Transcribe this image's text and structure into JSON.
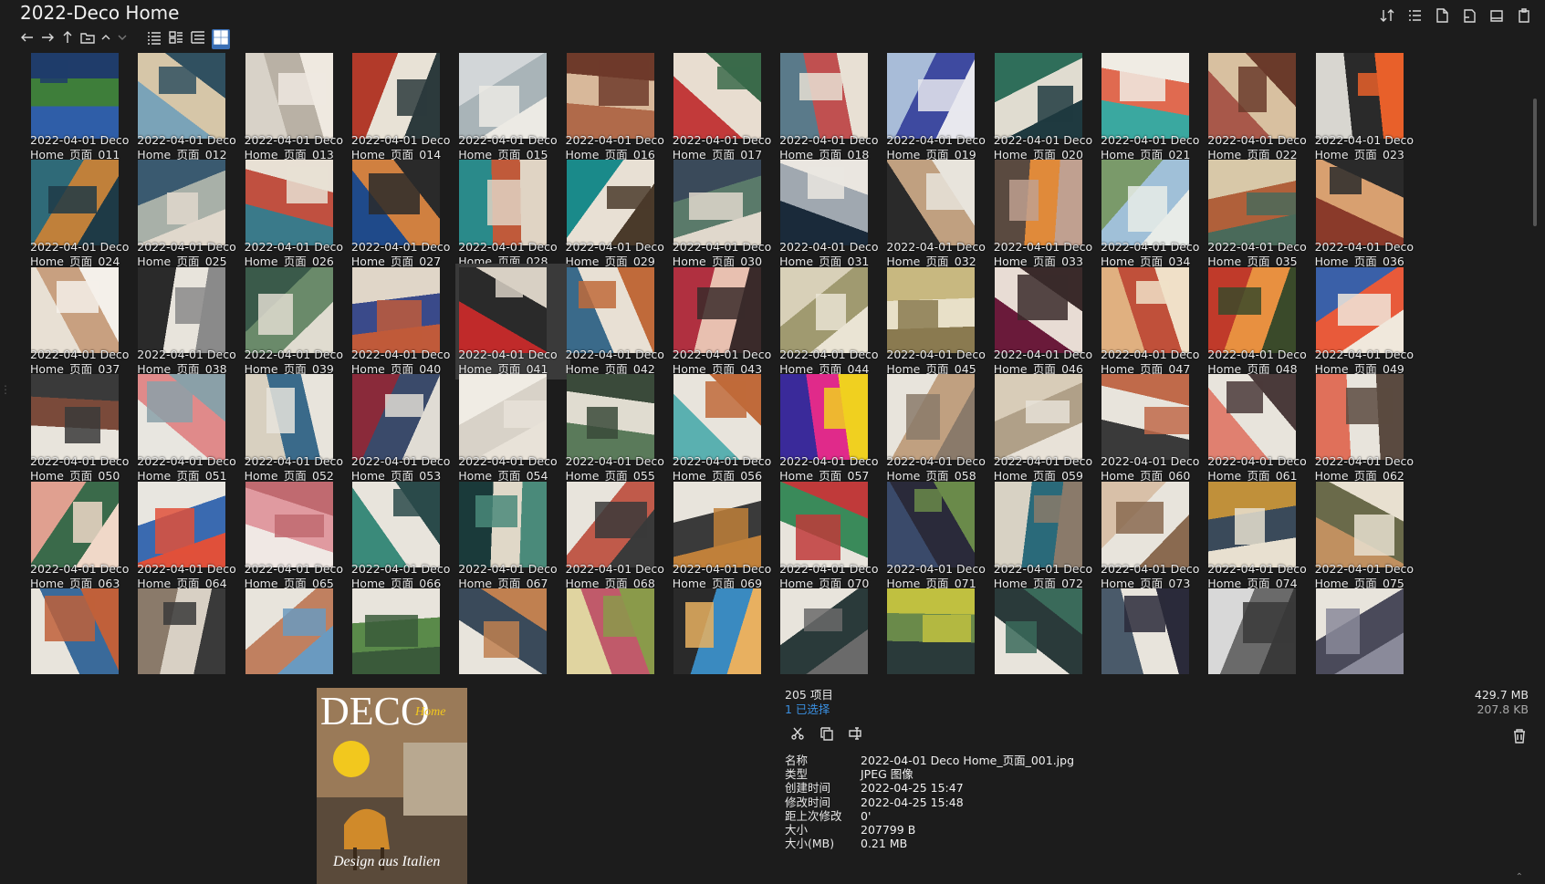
{
  "window": {
    "title": "2022-Deco Home"
  },
  "toolbar": {
    "right_icons": [
      "sort-icon",
      "list-view-icon",
      "new-file-icon",
      "new-folder-icon",
      "copy-window-icon",
      "clipboard-icon"
    ],
    "nav_icons": [
      "back-arrow-icon",
      "forward-arrow-icon",
      "up-arrow-icon",
      "open-folder-icon",
      "chevron-up-icon",
      "chevron-down-icon",
      "details-view-icon",
      "list-view-icon",
      "tree-view-icon",
      "thumbnail-view-icon"
    ]
  },
  "grid": {
    "caption_prefix": "2022-04-01 Deco",
    "items": [
      {
        "line2": "Home_页面_011",
        "tones": [
          "#2f5ea8",
          "#3e7e3a",
          "#1f3c6a"
        ]
      },
      {
        "line2": "Home_页面_012",
        "tones": [
          "#7aa3b8",
          "#d6c6a8",
          "#305060"
        ]
      },
      {
        "line2": "Home_页面_013",
        "tones": [
          "#d8d2c8",
          "#b9b1a5",
          "#efe9e0"
        ]
      },
      {
        "line2": "Home_页面_014",
        "tones": [
          "#b23a2a",
          "#e8e2d6",
          "#2c3a3c"
        ]
      },
      {
        "line2": "Home_页面_015",
        "tones": [
          "#d2d6d8",
          "#a9b4b8",
          "#eceae4"
        ]
      },
      {
        "line2": "Home_页面_016",
        "tones": [
          "#b06a4a",
          "#d8b89a",
          "#6e3a2a"
        ]
      },
      {
        "line2": "Home_页面_017",
        "tones": [
          "#c23a3a",
          "#e8ddd0",
          "#3a6a4a"
        ]
      },
      {
        "line2": "Home_页面_018",
        "tones": [
          "#5a7a8a",
          "#c05050",
          "#e8e0d4"
        ]
      },
      {
        "line2": "Home_页面_019",
        "tones": [
          "#a8bcd8",
          "#3e4aa0",
          "#e8e8ee"
        ]
      },
      {
        "line2": "Home_页面_020",
        "tones": [
          "#2f6e5a",
          "#e0dcd0",
          "#1f3a40"
        ]
      },
      {
        "line2": "Home_页面_021",
        "tones": [
          "#3aa8a0",
          "#e06a50",
          "#f0ece4"
        ]
      },
      {
        "line2": "Home_页面_022",
        "tones": [
          "#a8584a",
          "#d8c0a0",
          "#6a3a2a"
        ]
      },
      {
        "line2": "Home_页面_023",
        "tones": [
          "#d8d6d0",
          "#2a2a2a",
          "#e8602a"
        ]
      },
      {
        "line2": "Home_页面_024",
        "tones": [
          "#2f6a78",
          "#c0803a",
          "#1e3a46"
        ]
      },
      {
        "line2": "Home_页面_025",
        "tones": [
          "#3a5a70",
          "#a8b0a8",
          "#e0d8cc"
        ]
      },
      {
        "line2": "Home_页面_026",
        "tones": [
          "#3a7a8a",
          "#c05040",
          "#e8e0d4"
        ]
      },
      {
        "line2": "Home_页面_027",
        "tones": [
          "#1f4a8a",
          "#d08040",
          "#2a2a2a"
        ]
      },
      {
        "line2": "Home_页面_028",
        "tones": [
          "#2a8a8a",
          "#c05a3a",
          "#e0d4c4"
        ]
      },
      {
        "line2": "Home_页面_029",
        "tones": [
          "#1a8a8a",
          "#e8e0d4",
          "#4a3a2a"
        ]
      },
      {
        "line2": "Home_页面_030",
        "tones": [
          "#3a4a5a",
          "#5a7a6a",
          "#e0d8cc"
        ]
      },
      {
        "line2": "Home_页面_031",
        "tones": [
          "#1a2a3a",
          "#a0a8b0",
          "#eae6e0"
        ]
      },
      {
        "line2": "Home_页面_032",
        "tones": [
          "#2a2a2a",
          "#c0a080",
          "#e8e4dc"
        ]
      },
      {
        "line2": "Home_页面_033",
        "tones": [
          "#5a4a40",
          "#e08a3a",
          "#c0a090"
        ]
      },
      {
        "line2": "Home_页面_034",
        "tones": [
          "#7a9a6a",
          "#a0c0d8",
          "#e8ece8"
        ]
      },
      {
        "line2": "Home_页面_035",
        "tones": [
          "#d8c8a8",
          "#b0603a",
          "#4a6a5a"
        ]
      },
      {
        "line2": "Home_页面_036",
        "tones": [
          "#8a3a2a",
          "#d8a070",
          "#2a2a2a"
        ]
      },
      {
        "line2": "Home_页面_037",
        "tones": [
          "#e8e0d4",
          "#c8a080",
          "#f4f0ea"
        ]
      },
      {
        "line2": "Home_页面_038",
        "tones": [
          "#2a2a2a",
          "#e8e4dc",
          "#8a8a8a"
        ]
      },
      {
        "line2": "Home_页面_039",
        "tones": [
          "#3a5a4a",
          "#6a8a6a",
          "#e0dcd0"
        ]
      },
      {
        "line2": "Home_页面_040",
        "tones": [
          "#e0d6c8",
          "#3a4a8a",
          "#c05a3a"
        ]
      },
      {
        "line2": "Home_页面_041",
        "tones": [
          "#c02a2a",
          "#2a2a2a",
          "#d8d0c4"
        ]
      },
      {
        "line2": "Home_页面_042",
        "tones": [
          "#3a6a8a",
          "#e8e0d4",
          "#c06a3a"
        ]
      },
      {
        "line2": "Home_页面_043",
        "tones": [
          "#b03040",
          "#e8c0b0",
          "#3a2a2a"
        ]
      },
      {
        "line2": "Home_页面_044",
        "tones": [
          "#d8d0b8",
          "#a09a70",
          "#eae4d4"
        ]
      },
      {
        "line2": "Home_页面_045",
        "tones": [
          "#c8b880",
          "#e8e0c8",
          "#8a7a50"
        ]
      },
      {
        "line2": "Home_页面_046",
        "tones": [
          "#6a1a3a",
          "#e8dcd4",
          "#3a2a2a"
        ]
      },
      {
        "line2": "Home_页面_047",
        "tones": [
          "#e0b080",
          "#c0503a",
          "#f0e0c8"
        ]
      },
      {
        "line2": "Home_页面_048",
        "tones": [
          "#c03a2a",
          "#e89040",
          "#3a4a2a"
        ]
      },
      {
        "line2": "Home_页面_049",
        "tones": [
          "#3a60a8",
          "#e85a3a",
          "#f0e8dc"
        ]
      },
      {
        "line2": "Home_页面_050",
        "tones": [
          "#e8e4dc",
          "#7a4a3a",
          "#3a3a3a"
        ]
      },
      {
        "line2": "Home_页面_051",
        "tones": [
          "#e8e6e0",
          "#e08a8a",
          "#8aa0a8"
        ]
      },
      {
        "line2": "Home_页面_052",
        "tones": [
          "#d8d0c0",
          "#3a6a8a",
          "#e8e4dc"
        ]
      },
      {
        "line2": "Home_页面_053",
        "tones": [
          "#8a2a3a",
          "#3a4a6a",
          "#e0dcd4"
        ]
      },
      {
        "line2": "Home_页面_054",
        "tones": [
          "#f0ece4",
          "#d8d2c8",
          "#e8e2d8"
        ]
      },
      {
        "line2": "Home_页面_055",
        "tones": [
          "#5a7a5a",
          "#e0dcd0",
          "#3a4a3a"
        ]
      },
      {
        "line2": "Home_页面_056",
        "tones": [
          "#5ab0b0",
          "#e8e4dc",
          "#c06a3a"
        ]
      },
      {
        "line2": "Home_页面_057",
        "tones": [
          "#3a2a9a",
          "#e02a8a",
          "#f0d020"
        ]
      },
      {
        "line2": "Home_页面_058",
        "tones": [
          "#e8e4dc",
          "#c0a080",
          "#8a7a6a"
        ]
      },
      {
        "line2": "Home_页面_059",
        "tones": [
          "#d8ccb8",
          "#b0a088",
          "#e8e2d8"
        ]
      },
      {
        "line2": "Home_页面_060",
        "tones": [
          "#3a3a3a",
          "#e8e4dc",
          "#c06a4a"
        ]
      },
      {
        "line2": "Home_页面_061",
        "tones": [
          "#e08070",
          "#e8e4dc",
          "#4a3a3a"
        ]
      },
      {
        "line2": "Home_页面_062",
        "tones": [
          "#e0705a",
          "#e8e4dc",
          "#5a4a40"
        ]
      },
      {
        "line2": "Home_页面_063",
        "tones": [
          "#e0a090",
          "#3a6a4a",
          "#f0d8c8"
        ]
      },
      {
        "line2": "Home_页面_064",
        "tones": [
          "#e8e6e0",
          "#3a6ab0",
          "#e0503a"
        ]
      },
      {
        "line2": "Home_页面_065",
        "tones": [
          "#f0e8e4",
          "#e09aa0",
          "#c06a70"
        ]
      },
      {
        "line2": "Home_页面_066",
        "tones": [
          "#3a8a7a",
          "#e8e4dc",
          "#2a4a4a"
        ]
      },
      {
        "line2": "Home_页面_067",
        "tones": [
          "#1a3a3a",
          "#e0d8c8",
          "#4a8a7a"
        ]
      },
      {
        "line2": "Home_页面_068",
        "tones": [
          "#e8e4dc",
          "#c05a4a",
          "#3a3a3a"
        ]
      },
      {
        "line2": "Home_页面_069",
        "tones": [
          "#e8e4dc",
          "#3a3a3a",
          "#c0803a"
        ]
      },
      {
        "line2": "Home_页面_070",
        "tones": [
          "#e8e4dc",
          "#3a8a5a",
          "#c03a3a"
        ]
      },
      {
        "line2": "Home_页面_071",
        "tones": [
          "#3a4a6a",
          "#2a2a3a",
          "#6a8a4a"
        ]
      },
      {
        "line2": "Home_页面_072",
        "tones": [
          "#d8d2c4",
          "#2a6a7a",
          "#8a7a6a"
        ]
      },
      {
        "line2": "Home_页面_073",
        "tones": [
          "#d8c0a8",
          "#e8e4dc",
          "#8a6a50"
        ]
      },
      {
        "line2": "Home_页面_074",
        "tones": [
          "#c0903a",
          "#3a4a5a",
          "#e8e0d0"
        ]
      },
      {
        "line2": "Home_页面_075",
        "tones": [
          "#c09060",
          "#6a6a4a",
          "#e8e0d0"
        ]
      },
      {
        "line2": "",
        "tones": [
          "#e8e4dc",
          "#3a6a9a",
          "#c0603a"
        ]
      },
      {
        "line2": "",
        "tones": [
          "#8a7a6a",
          "#d8d0c4",
          "#3a3a3a"
        ]
      },
      {
        "line2": "",
        "tones": [
          "#e8e4dc",
          "#c08060",
          "#6a9ac0"
        ]
      },
      {
        "line2": "",
        "tones": [
          "#e8e4dc",
          "#5a8a4a",
          "#3a5a3a"
        ]
      },
      {
        "line2": "",
        "tones": [
          "#e8e4dc",
          "#3a4a5a",
          "#c08050"
        ]
      },
      {
        "line2": "",
        "tones": [
          "#e0d4a0",
          "#c05a6a",
          "#8a9a4a"
        ]
      },
      {
        "line2": "",
        "tones": [
          "#2a2a2a",
          "#3a8ac0",
          "#e8b060"
        ]
      },
      {
        "line2": "",
        "tones": [
          "#e8e4dc",
          "#2a3a3a",
          "#6a6a6a"
        ]
      },
      {
        "line2": "",
        "tones": [
          "#2a3a3a",
          "#6a8a4a",
          "#c0c040"
        ]
      },
      {
        "line2": "",
        "tones": [
          "#e8e4dc",
          "#2a3a3a",
          "#3a6a5a"
        ]
      },
      {
        "line2": "",
        "tones": [
          "#4a5a6a",
          "#e8e4dc",
          "#2a2a3a"
        ]
      },
      {
        "line2": "",
        "tones": [
          "#d8d8d8",
          "#6a6a6a",
          "#3a3a3a"
        ]
      },
      {
        "line2": "",
        "tones": [
          "#e8e4dc",
          "#4a4a5a",
          "#8a8a9a"
        ]
      }
    ]
  },
  "details": {
    "item_count": "205 项目",
    "selected_count": "1 已选择",
    "total_size": "429.7 MB",
    "selected_size": "207.8 KB",
    "action_icons": [
      "cut-icon",
      "copy-icon",
      "rename-icon"
    ],
    "properties": [
      {
        "key": "名称",
        "value": "2022-04-01 Deco Home_页面_001.jpg"
      },
      {
        "key": "类型",
        "value": "JPEG 图像"
      },
      {
        "key": "创建时间",
        "value": "2022-04-25  15:47"
      },
      {
        "key": "修改时间",
        "value": "2022-04-25  15:48"
      },
      {
        "key": "距上次修改",
        "value": "0'"
      },
      {
        "key": "大小",
        "value": "207799 B"
      },
      {
        "key": "大小(MB)",
        "value": "0.21 MB"
      }
    ]
  },
  "preview": {
    "masthead": "DECO",
    "script_word": "Home",
    "cover_line": "Design aus Italien",
    "colors": {
      "bg": "#8a6a4a",
      "sun": "#f2c81e",
      "chair": "#d08a2a",
      "text": "#ffffff"
    }
  },
  "colors": {
    "background": "#1c1c1c",
    "accent": "#3a8fe0",
    "selected_tile": "#3a3a3a"
  }
}
